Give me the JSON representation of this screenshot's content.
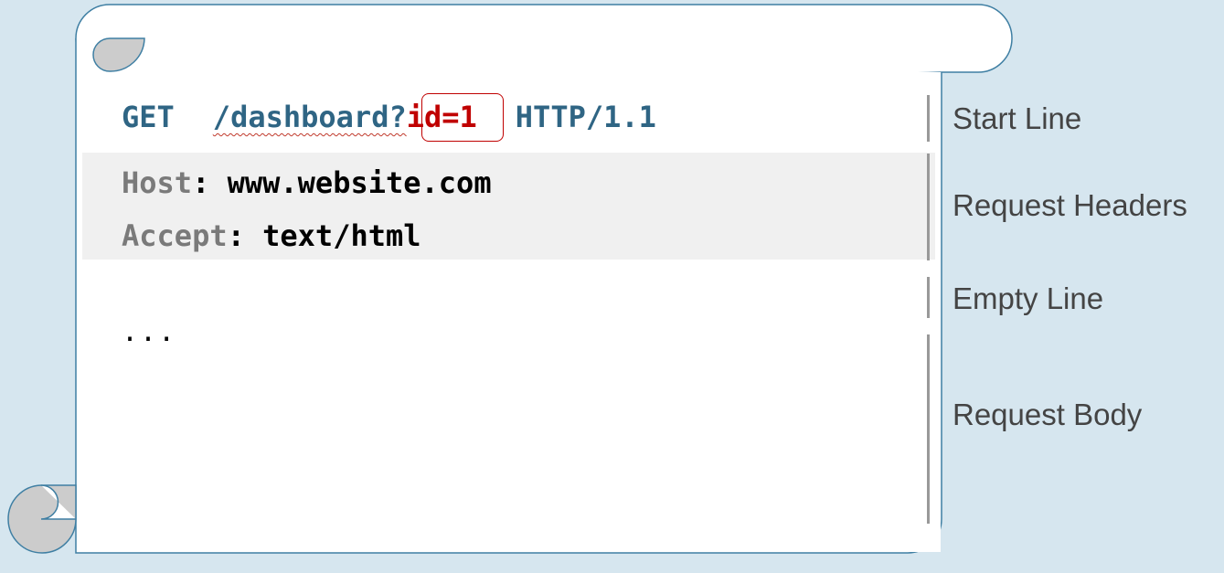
{
  "request": {
    "start_line": {
      "method": "GET",
      "path": "/dashboard?",
      "param": "id=1",
      "version": "HTTP/1.1"
    },
    "headers": [
      {
        "name": "Host",
        "value": "www.website.com"
      },
      {
        "name": "Accept",
        "value": "text/html"
      }
    ],
    "body": "..."
  },
  "labels": {
    "start_line": "Start Line",
    "request_headers": "Request Headers",
    "empty_line": "Empty Line",
    "request_body": "Request Body"
  },
  "colors": {
    "background": "#d6e6ef",
    "scroll_border": "#3f7fa3",
    "start_line_text": "#2f6584",
    "highlight": "#c00000",
    "header_name": "#7a7a7a",
    "headers_band": "#f0f0f0"
  }
}
